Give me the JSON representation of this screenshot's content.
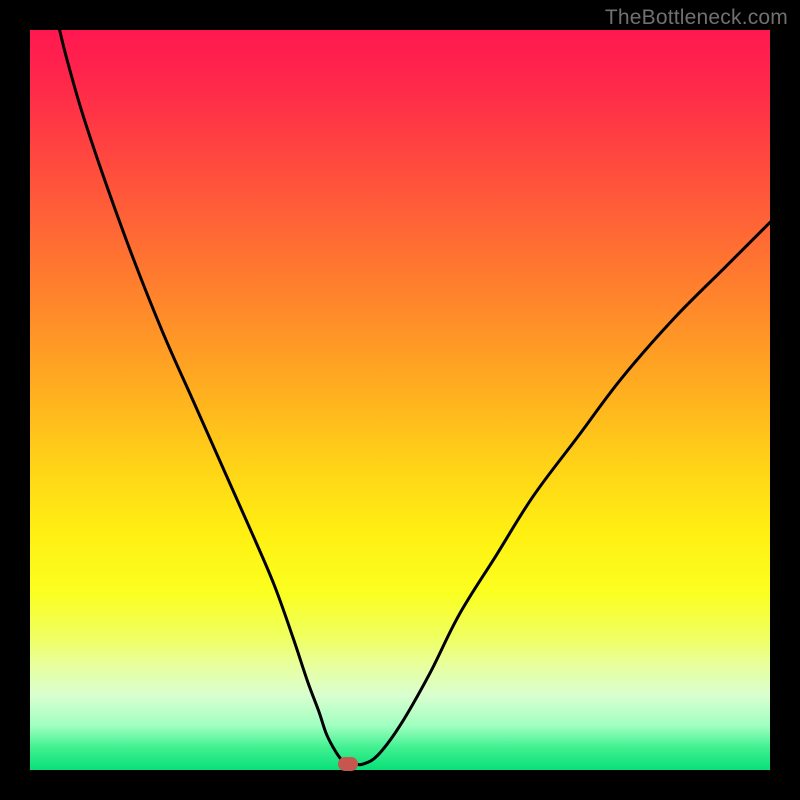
{
  "watermark": "TheBottleneck.com",
  "chart_data": {
    "type": "line",
    "title": "",
    "xlabel": "",
    "ylabel": "",
    "xlim": [
      0,
      100
    ],
    "ylim": [
      0,
      100
    ],
    "grid": false,
    "legend": false,
    "background": "rainbow_gradient_red_to_green_vertical",
    "series": [
      {
        "name": "bottleneck-curve",
        "color": "#000000",
        "x": [
          4,
          5,
          7,
          10,
          14,
          18,
          22,
          26,
          30,
          33,
          35.5,
          37.5,
          39,
          40,
          41,
          42,
          43,
          44,
          45,
          47,
          50,
          54,
          58,
          63,
          68,
          74,
          80,
          87,
          94,
          100
        ],
        "y": [
          100,
          96,
          89,
          80,
          69,
          59,
          50,
          41,
          32,
          25,
          18,
          12,
          8,
          5,
          3,
          1.5,
          0.8,
          0.8,
          0.8,
          2,
          6,
          13,
          21,
          29,
          37,
          45,
          53,
          61,
          68,
          74
        ]
      }
    ],
    "marker": {
      "x": 43,
      "y": 0.8,
      "color": "#c6574e",
      "shape": "rounded-rect"
    }
  }
}
